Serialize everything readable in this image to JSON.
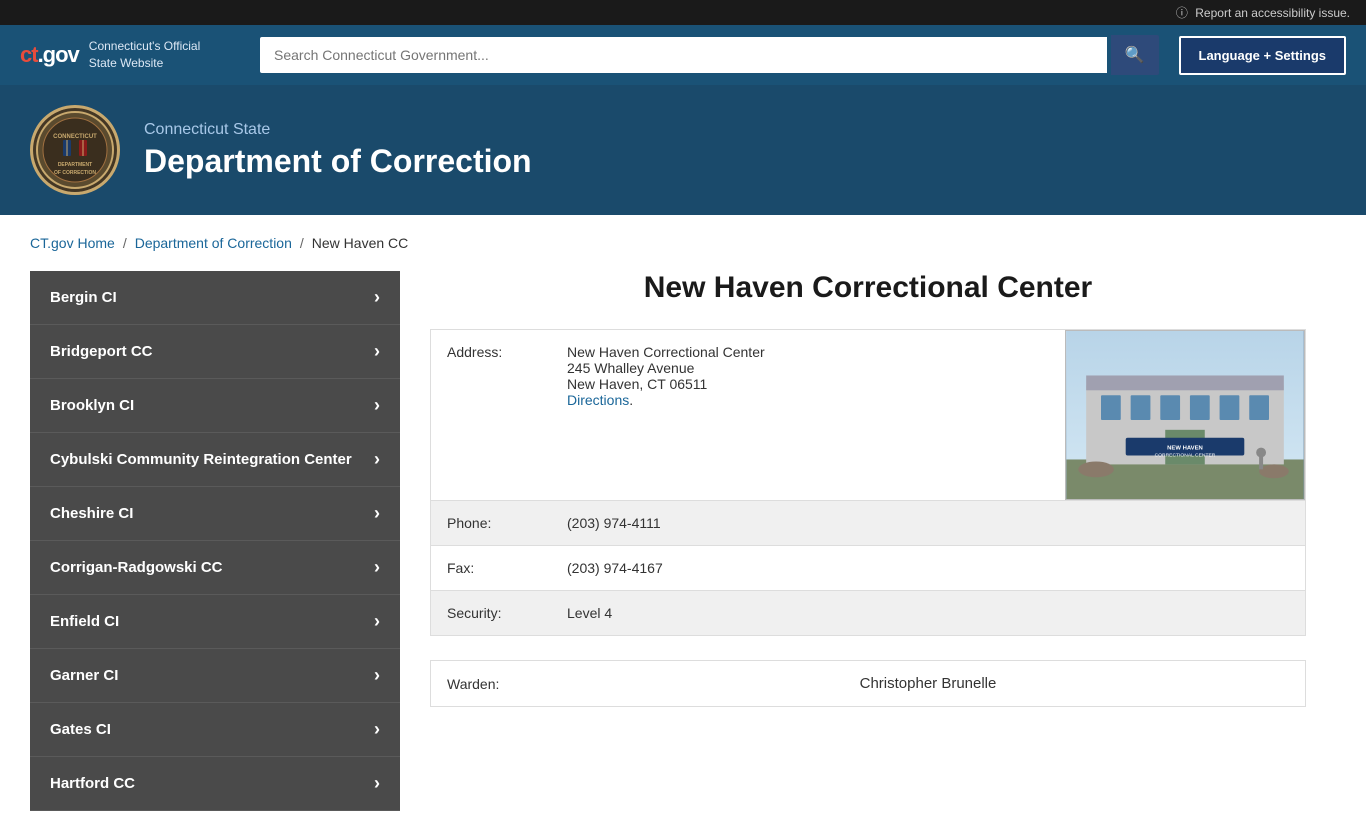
{
  "topbar": {
    "accessibility_link": "Report an accessibility issue."
  },
  "navbar": {
    "logo": "ct.gov",
    "logo_ct": "ct",
    "logo_gov": ".gov",
    "site_name_line1": "Connecticut's Official",
    "site_name_line2": "State Website",
    "search_placeholder": "Search Connecticut Government...",
    "search_btn_label": "🔍",
    "lang_btn": "Language + Settings"
  },
  "dept_header": {
    "subtitle": "Connecticut State",
    "title": "Department of Correction",
    "logo_text": "DEPARTMENT\nOF\nCORRECTION"
  },
  "breadcrumb": {
    "home": "CT.gov Home",
    "dept": "Department of Correction",
    "current": "New Haven CC"
  },
  "sidebar": {
    "items": [
      {
        "label": "Bergin CI"
      },
      {
        "label": "Bridgeport CC"
      },
      {
        "label": "Brooklyn CI"
      },
      {
        "label": "Cybulski Community Reintegration Center"
      },
      {
        "label": "Cheshire CI"
      },
      {
        "label": "Corrigan-Radgowski CC"
      },
      {
        "label": "Enfield CI"
      },
      {
        "label": "Garner CI"
      },
      {
        "label": "Gates CI"
      },
      {
        "label": "Hartford CC"
      }
    ]
  },
  "main": {
    "page_title": "New Haven Correctional Center",
    "address_label": "Address:",
    "address_line1": "New Haven Correctional Center",
    "address_line2": "245 Whalley Avenue",
    "address_line3": "New Haven, CT 06511",
    "directions_link": "Directions",
    "phone_label": "Phone:",
    "phone_value": "(203) 974-4111",
    "fax_label": "Fax:",
    "fax_value": "(203) 974-4167",
    "security_label": "Security:",
    "security_value": "Level 4",
    "warden_label": "Warden:",
    "warden_name": "Christopher Brunelle",
    "photo_alt": "New Haven Correctional Center Building"
  }
}
